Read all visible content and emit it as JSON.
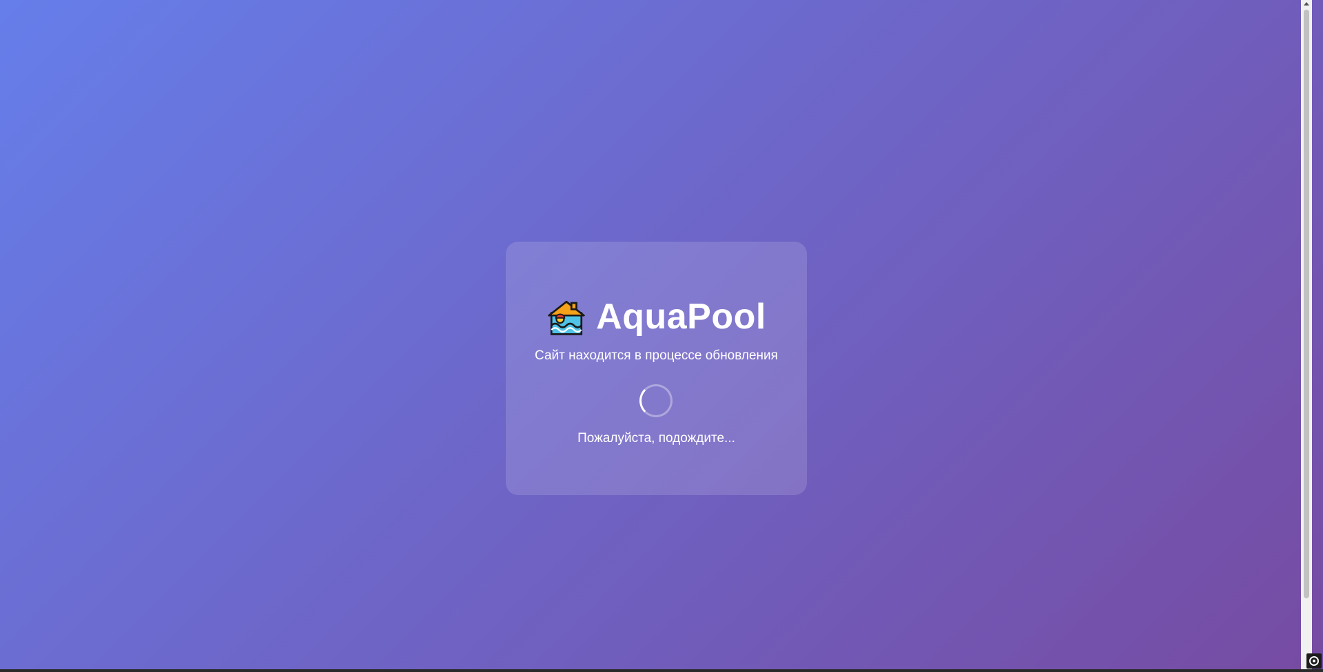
{
  "brand": {
    "icon": "house-pool-icon",
    "name": "AquaPool"
  },
  "status": {
    "subtitle": "Сайт находится в процессе обновления",
    "wait_text": "Пожалуйста, подождите..."
  },
  "colors": {
    "gradient_start": "#667eea",
    "gradient_end": "#764ba2",
    "text": "#ffffff"
  }
}
